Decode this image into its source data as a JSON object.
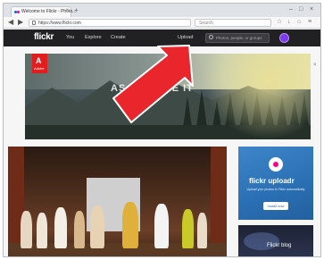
{
  "browser": {
    "tab_title": "Welcome to Flickr - Photo...",
    "tab_close": "×",
    "new_tab": "+",
    "window_controls": {
      "minimize": "–",
      "maximize": "□",
      "close": "×"
    },
    "back": "◀",
    "forward": "▶",
    "url": "https://www.flickr.com",
    "search_placeholder": "Search",
    "toolbar_icons": [
      "star-icon",
      "download-icon",
      "home-icon",
      "menu-icon"
    ]
  },
  "flickr": {
    "logo": "flickr",
    "nav": {
      "you": "You",
      "explore": "Explore",
      "create": "Create"
    },
    "upload": "Upload",
    "search_placeholder": "Photos, people, or groups",
    "brand_colors": {
      "blue": "#0063dc",
      "pink": "#ff0084"
    }
  },
  "banner": {
    "brand": "Adobe",
    "tagline": "AS YOU SEE IT",
    "close": "×"
  },
  "uploadr_ad": {
    "title": "flickr uploadr",
    "description": "Upload your photos to Flickr automatically",
    "button": "Install now"
  },
  "blog": {
    "title": "Flickr blog"
  },
  "overlay": {
    "arrow_color": "#e8262c",
    "arrow_outline": "#ffffff"
  }
}
